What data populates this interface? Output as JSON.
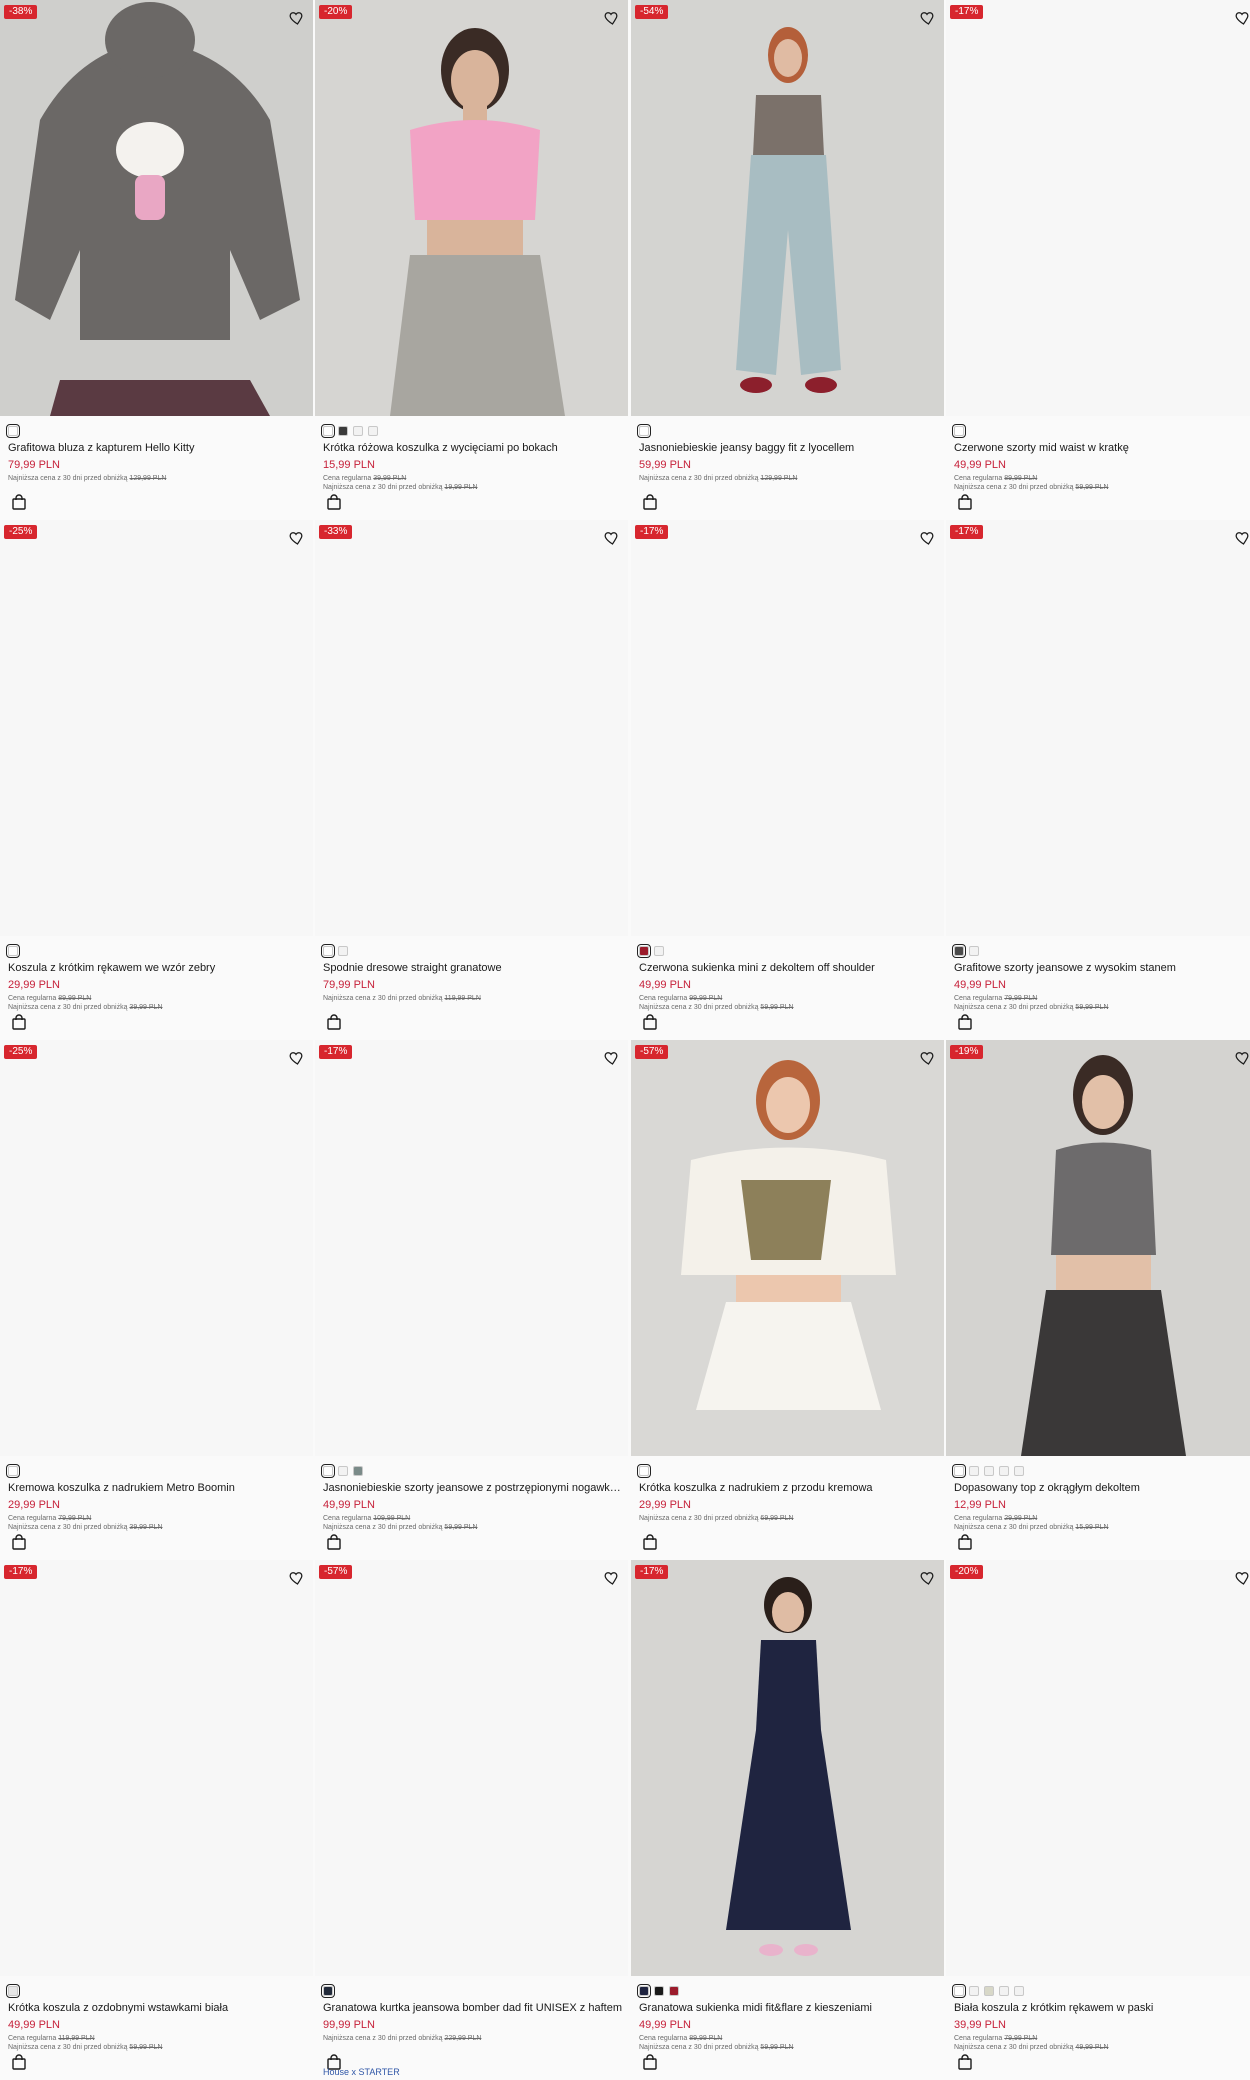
{
  "labels": {
    "regular": "Cena regularna",
    "lowest": "Najniższa cena z 30 dni przed obniżką"
  },
  "colors": {
    "sale_badge": "#d7262e",
    "price": "#c6213a",
    "collab_link": "#3057a7"
  },
  "products": [
    {
      "badge": "-38%",
      "name": "Grafitowa bluza z kapturem Hello Kitty",
      "price": "79,99 PLN",
      "regular": "",
      "lowest": "129,99 PLN",
      "swatches": [
        "#ffffff"
      ],
      "photo": "hoodie",
      "collab": ""
    },
    {
      "badge": "-20%",
      "name": "Krótka różowa koszulka z wycięciami po bokach",
      "price": "15,99 PLN",
      "regular": "39,99 PLN",
      "lowest": "19,99 PLN",
      "swatches": [
        "#ffffff",
        "#3a3a3a",
        "#f2f2f2",
        "#f2f2f2"
      ],
      "photo": "pink",
      "collab": ""
    },
    {
      "badge": "-54%",
      "name": "Jasnoniebieskie jeansy baggy fit z lyocellem",
      "price": "59,99 PLN",
      "regular": "",
      "lowest": "129,99 PLN",
      "swatches": [
        "#ffffff"
      ],
      "photo": "jeans",
      "collab": ""
    },
    {
      "badge": "-17%",
      "name": "Czerwone szorty mid waist w kratkę",
      "price": "49,99 PLN",
      "regular": "89,99 PLN",
      "lowest": "59,99 PLN",
      "swatches": [
        "#ffffff"
      ],
      "photo": "",
      "collab": ""
    },
    {
      "badge": "-25%",
      "name": "Koszula z krótkim rękawem we wzór zebry",
      "price": "29,99 PLN",
      "regular": "89,99 PLN",
      "lowest": "39,99 PLN",
      "swatches": [
        "#ffffff"
      ],
      "photo": "",
      "collab": ""
    },
    {
      "badge": "-33%",
      "name": "Spodnie dresowe straight granatowe",
      "price": "79,99 PLN",
      "regular": "",
      "lowest": "119,99 PLN",
      "swatches": [
        "#ffffff",
        "#f2f2f2"
      ],
      "photo": "",
      "collab": ""
    },
    {
      "badge": "-17%",
      "name": "Czerwona sukienka mini z dekoltem off shoulder",
      "price": "49,99 PLN",
      "regular": "99,99 PLN",
      "lowest": "59,99 PLN",
      "swatches": [
        "#9b1b2b",
        "#f2f2f2"
      ],
      "photo": "",
      "collab": ""
    },
    {
      "badge": "-17%",
      "name": "Grafitowe szorty jeansowe z wysokim stanem",
      "price": "49,99 PLN",
      "regular": "79,99 PLN",
      "lowest": "59,99 PLN",
      "swatches": [
        "#4a4a4a",
        "#f2f2f2"
      ],
      "photo": "",
      "collab": ""
    },
    {
      "badge": "-25%",
      "name": "Kremowa koszulka z nadrukiem Metro Boomin",
      "price": "29,99 PLN",
      "regular": "79,99 PLN",
      "lowest": "39,99 PLN",
      "swatches": [
        "#ffffff"
      ],
      "photo": "",
      "collab": ""
    },
    {
      "badge": "-17%",
      "name": "Jasnoniebieskie szorty jeansowe z postrzępionymi nogawkami",
      "price": "49,99 PLN",
      "regular": "109,99 PLN",
      "lowest": "59,99 PLN",
      "swatches": [
        "#ffffff",
        "#f2f2f2",
        "#7a8a88"
      ],
      "photo": "",
      "collab": ""
    },
    {
      "badge": "-57%",
      "name": "Krótka koszulka z nadrukiem z przodu kremowa",
      "price": "29,99 PLN",
      "regular": "",
      "lowest": "69,99 PLN",
      "swatches": [
        "#ffffff"
      ],
      "photo": "cream",
      "collab": ""
    },
    {
      "badge": "-19%",
      "name": "Dopasowany top z okrągłym dekoltem",
      "price": "12,99 PLN",
      "regular": "29,99 PLN",
      "lowest": "15,99 PLN",
      "swatches": [
        "#ffffff",
        "#f2f2f2",
        "#f2f2f2",
        "#f2f2f2",
        "#f2f2f2"
      ],
      "photo": "tank",
      "collab": ""
    },
    {
      "badge": "-17%",
      "name": "Krótka koszula z ozdobnymi wstawkami biała",
      "price": "49,99 PLN",
      "regular": "119,99 PLN",
      "lowest": "59,99 PLN",
      "swatches": [
        "#e6e6e6"
      ],
      "photo": "",
      "collab": ""
    },
    {
      "badge": "-57%",
      "name": "Granatowa kurtka jeansowa bomber dad fit UNISEX z haftem",
      "price": "99,99 PLN",
      "regular": "",
      "lowest": "229,99 PLN",
      "swatches": [
        "#222a3a"
      ],
      "photo": "",
      "collab": "House x STARTER"
    },
    {
      "badge": "-17%",
      "name": "Granatowa sukienka midi fit&flare z kieszeniami",
      "price": "49,99 PLN",
      "regular": "89,99 PLN",
      "lowest": "59,99 PLN",
      "swatches": [
        "#1f2440",
        "#1a1a1a",
        "#9b1b2b"
      ],
      "photo": "dress",
      "collab": ""
    },
    {
      "badge": "-20%",
      "name": "Biała koszula z krótkim rękawem w paski",
      "price": "39,99 PLN",
      "regular": "79,99 PLN",
      "lowest": "49,99 PLN",
      "swatches": [
        "#ffffff",
        "#f2f2f2",
        "#d8d8c8",
        "#f2f2f2",
        "#f2f2f2"
      ],
      "photo": "",
      "collab": ""
    }
  ]
}
